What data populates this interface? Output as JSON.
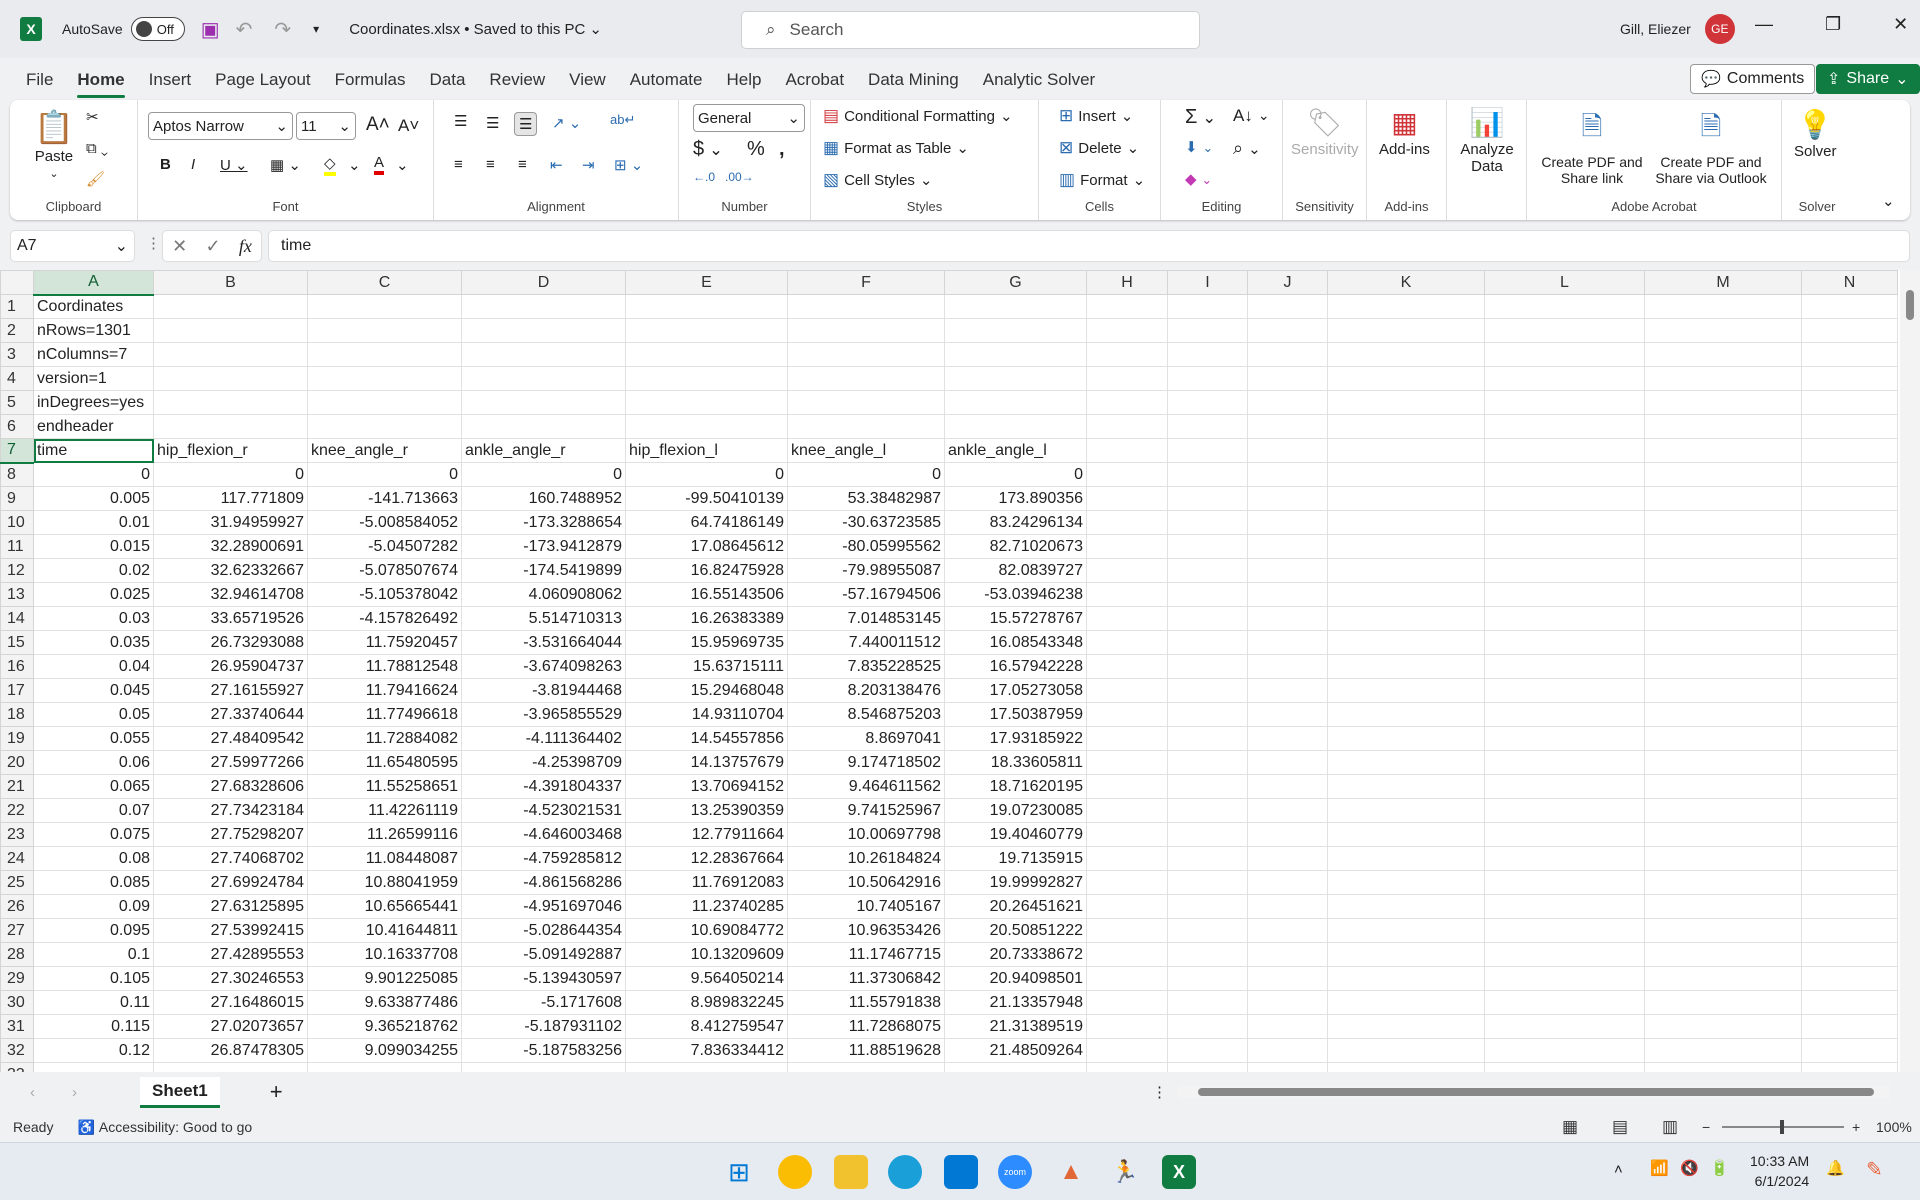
{
  "titlebar": {
    "autosave_label": "AutoSave",
    "autosave_state": "Off",
    "filename": "Coordinates.xlsx • Saved to this PC",
    "search_placeholder": "Search",
    "user": "Gill, Eliezer",
    "initials": "GE"
  },
  "menu": {
    "tabs": [
      "File",
      "Home",
      "Insert",
      "Page Layout",
      "Formulas",
      "Data",
      "Review",
      "View",
      "Automate",
      "Help",
      "Acrobat",
      "Data Mining",
      "Analytic Solver"
    ],
    "active": "Home",
    "comments": "Comments",
    "share": "Share"
  },
  "ribbon": {
    "clipboard": {
      "label": "Clipboard",
      "paste": "Paste"
    },
    "font": {
      "label": "Font",
      "name": "Aptos Narrow",
      "size": "11",
      "highlight_color": "#ffff00",
      "font_color": "#e00000"
    },
    "alignment": {
      "label": "Alignment"
    },
    "number": {
      "label": "Number",
      "format": "General"
    },
    "styles": {
      "label": "Styles",
      "conditional": "Conditional Formatting",
      "format_table": "Format as Table",
      "cell_styles": "Cell Styles"
    },
    "cells": {
      "label": "Cells",
      "insert": "Insert",
      "delete": "Delete",
      "format": "Format"
    },
    "editing": {
      "label": "Editing"
    },
    "sensitivity": {
      "label": "Sensitivity",
      "button": "Sensitivity"
    },
    "addins": {
      "label": "Add-ins",
      "button": "Add-ins"
    },
    "analyze": {
      "button": "Analyze Data"
    },
    "acrobat": {
      "label": "Adobe Acrobat",
      "pdf_share": "Create PDF and Share link",
      "pdf_outlook": "Create PDF and Share via Outlook"
    },
    "solver": {
      "label": "Solver",
      "button": "Solver"
    }
  },
  "formula_bar": {
    "name_box": "A7",
    "formula": "time"
  },
  "columns": [
    "A",
    "B",
    "C",
    "D",
    "E",
    "F",
    "G",
    "H",
    "I",
    "J",
    "K",
    "L",
    "M",
    "N"
  ],
  "active_cell": "A7",
  "rows": [
    [
      "Coordinates"
    ],
    [
      "nRows=1301"
    ],
    [
      "nColumns=7"
    ],
    [
      "version=1"
    ],
    [
      "inDegrees=yes"
    ],
    [
      "endheader"
    ],
    [
      "time",
      "hip_flexion_r",
      "knee_angle_r",
      "ankle_angle_r",
      "hip_flexion_l",
      "knee_angle_l",
      "ankle_angle_l"
    ],
    [
      "0",
      "0",
      "0",
      "0",
      "0",
      "0",
      "0"
    ],
    [
      "0.005",
      "117.771809",
      "-141.713663",
      "160.7488952",
      "-99.50410139",
      "53.38482987",
      "173.890356"
    ],
    [
      "0.01",
      "31.94959927",
      "-5.008584052",
      "-173.3288654",
      "64.74186149",
      "-30.63723585",
      "83.24296134"
    ],
    [
      "0.015",
      "32.28900691",
      "-5.04507282",
      "-173.9412879",
      "17.08645612",
      "-80.05995562",
      "82.71020673"
    ],
    [
      "0.02",
      "32.62332667",
      "-5.078507674",
      "-174.5419899",
      "16.82475928",
      "-79.98955087",
      "82.0839727"
    ],
    [
      "0.025",
      "32.94614708",
      "-5.105378042",
      "4.060908062",
      "16.55143506",
      "-57.16794506",
      "-53.03946238"
    ],
    [
      "0.03",
      "33.65719526",
      "-4.157826492",
      "5.514710313",
      "16.26383389",
      "7.014853145",
      "15.57278767"
    ],
    [
      "0.035",
      "26.73293088",
      "11.75920457",
      "-3.531664044",
      "15.95969735",
      "7.440011512",
      "16.08543348"
    ],
    [
      "0.04",
      "26.95904737",
      "11.78812548",
      "-3.674098263",
      "15.63715111",
      "7.835228525",
      "16.57942228"
    ],
    [
      "0.045",
      "27.16155927",
      "11.79416624",
      "-3.81944468",
      "15.29468048",
      "8.203138476",
      "17.05273058"
    ],
    [
      "0.05",
      "27.33740644",
      "11.77496618",
      "-3.965855529",
      "14.93110704",
      "8.546875203",
      "17.50387959"
    ],
    [
      "0.055",
      "27.48409542",
      "11.72884082",
      "-4.111364402",
      "14.54557856",
      "8.8697041",
      "17.93185922"
    ],
    [
      "0.06",
      "27.59977266",
      "11.65480595",
      "-4.25398709",
      "14.13757679",
      "9.174718502",
      "18.33605811"
    ],
    [
      "0.065",
      "27.68328606",
      "11.55258651",
      "-4.391804337",
      "13.70694152",
      "9.464611562",
      "18.71620195"
    ],
    [
      "0.07",
      "27.73423184",
      "11.42261119",
      "-4.523021531",
      "13.25390359",
      "9.741525967",
      "19.07230085"
    ],
    [
      "0.075",
      "27.75298207",
      "11.26599116",
      "-4.646003468",
      "12.77911664",
      "10.00697798",
      "19.40460779"
    ],
    [
      "0.08",
      "27.74068702",
      "11.08448087",
      "-4.759285812",
      "12.28367664",
      "10.26184824",
      "19.7135915"
    ],
    [
      "0.085",
      "27.69924784",
      "10.88041959",
      "-4.861568286",
      "11.76912083",
      "10.50642916",
      "19.99992827"
    ],
    [
      "0.09",
      "27.63125895",
      "10.65665441",
      "-4.951697046",
      "11.23740285",
      "10.7405167",
      "20.26451621"
    ],
    [
      "0.095",
      "27.53992415",
      "10.41644811",
      "-5.028644354",
      "10.69084772",
      "10.96353426",
      "20.50851222"
    ],
    [
      "0.1",
      "27.42895553",
      "10.16337708",
      "-5.091492887",
      "10.13209609",
      "11.17467715",
      "20.73338672"
    ],
    [
      "0.105",
      "27.30246553",
      "9.901225085",
      "-5.139430597",
      "9.564050214",
      "11.37306842",
      "20.94098501"
    ],
    [
      "0.11",
      "27.16486015",
      "9.633877486",
      "-5.1717608",
      "8.989832245",
      "11.55791838",
      "21.13357948"
    ],
    [
      "0.115",
      "27.02073657",
      "9.365218762",
      "-5.187931102",
      "8.412759547",
      "11.72868075",
      "21.31389519"
    ],
    [
      "0.12",
      "26.87478305",
      "9.099034255",
      "-5.187583256",
      "7.836334412",
      "11.88519628",
      "21.48509264"
    ]
  ],
  "sheets": [
    "Sheet1"
  ],
  "status": {
    "ready": "Ready",
    "accessibility": "Accessibility: Good to go",
    "zoom": "100%"
  },
  "taskbar": {
    "time": "10:33 AM",
    "date": "6/1/2024"
  }
}
